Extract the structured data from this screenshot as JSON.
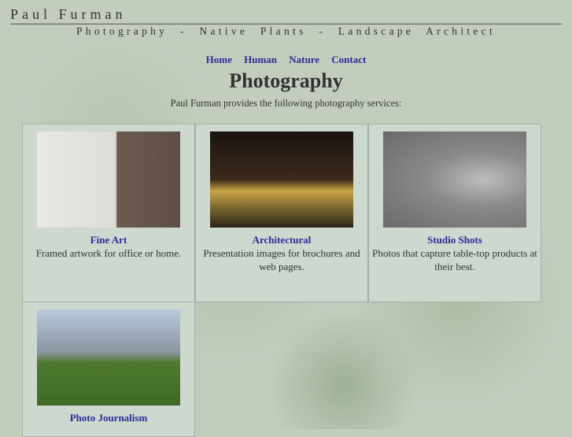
{
  "header": {
    "name": "Paul Furman",
    "tagline": "Photography - Native Plants - Landscape Architect"
  },
  "nav": [
    "Home",
    "Human",
    "Nature",
    "Contact"
  ],
  "title": "Photography",
  "intro": "Paul Furman provides the following photography services:",
  "services": [
    {
      "title": "Fine Art",
      "desc": "Framed artwork for office or home."
    },
    {
      "title": "Architectural",
      "desc": "Presentation images for brochures and web pages."
    },
    {
      "title": "Studio Shots",
      "desc": "Photos that capture table-top products at their best."
    },
    {
      "title": "Photo Journalism",
      "desc": ""
    }
  ]
}
